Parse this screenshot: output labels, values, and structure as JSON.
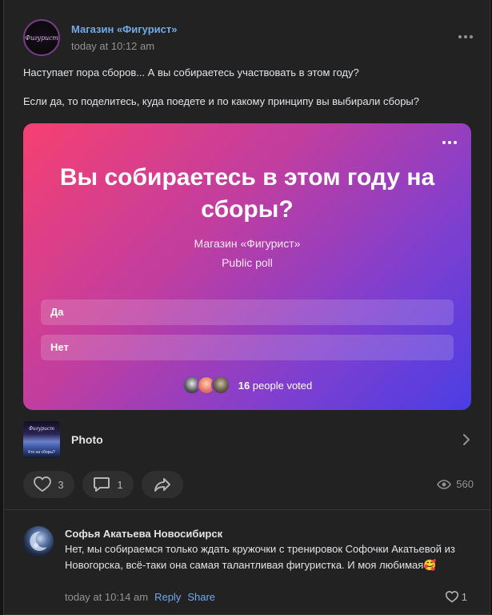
{
  "post": {
    "author": "Магазин «Фигурист»",
    "time": "today at 10:12 am",
    "avatar_logo_text": "Фигурист",
    "text_lines": [
      "Наступает пора сборов... А вы собираетесь участвовать в этом году?",
      "Если да, то поделитесь, куда поедете и по какому принципу вы выбирали сборы?"
    ]
  },
  "poll": {
    "question": "Вы собираетесь в этом году на сборы?",
    "owner": "Магазин «Фигурист»",
    "type": "Public poll",
    "options": [
      "Да",
      "Нет"
    ],
    "voters_count": "16",
    "voters_suffix": " people voted"
  },
  "attachment": {
    "label": "Photo",
    "thumb_caption": "Кто на сборы?"
  },
  "actions": {
    "likes": "3",
    "comments": "1",
    "views": "560"
  },
  "comment": {
    "author": "Софья Акатьева Новосибирск",
    "text": "Нет, мы собираемся только ждать кружочки с тренировок Софочки Акатьевой из Новогорска, всё-таки она самая талантливая фигуристка. И моя любимая🥰",
    "time": "today at 10:14 am",
    "reply_label": "Reply",
    "share_label": "Share",
    "likes": "1"
  },
  "colors": {
    "link": "#71aaeb",
    "card_bg": "#222222",
    "poll_gradient_start": "#f64070",
    "poll_gradient_end": "#4a3ee4"
  }
}
